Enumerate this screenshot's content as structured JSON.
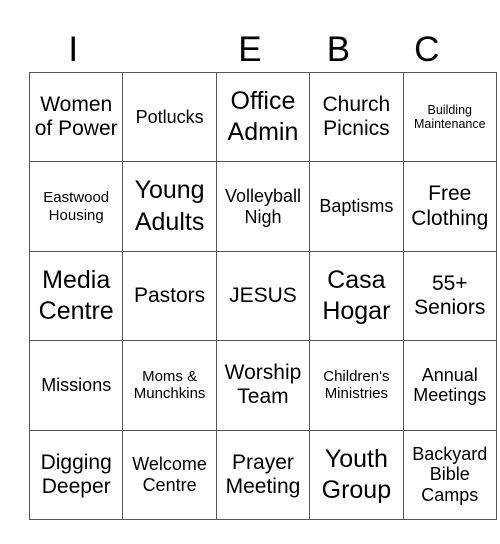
{
  "header": {
    "letters": [
      "I",
      "",
      "E",
      "B",
      "C"
    ]
  },
  "cells": [
    [
      "Women of Power",
      "Potlucks",
      "Office Admin",
      "Church Picnics",
      "Building Maintenance"
    ],
    [
      "Eastwood Housing",
      "Young Adults",
      "Volleyball Nigh",
      "Baptisms",
      "Free Clothing"
    ],
    [
      "Media Centre",
      "Pastors",
      "JESUS",
      "Casa Hogar",
      "55+ Seniors"
    ],
    [
      "Missions",
      "Moms & Munchkins",
      "Worship Team",
      "Children's Ministries",
      "Annual Meetings"
    ],
    [
      "Digging Deeper",
      "Welcome Centre",
      "Prayer Meeting",
      "Youth Group",
      "Backyard Bible Camps"
    ]
  ]
}
